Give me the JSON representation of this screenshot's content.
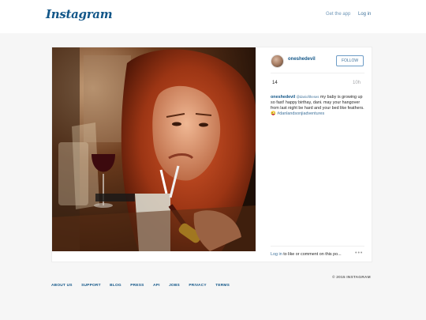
{
  "header": {
    "logo": "Instagram",
    "get_app": "Get the app",
    "login": "Log in"
  },
  "post": {
    "username": "oneshedevil",
    "follow": "FOLLOW",
    "likes": "14",
    "time": "10h",
    "caption": {
      "mention": "@danioftheses",
      "text": "my baby is growing up so fast! happy birthay, dani. may your hangover from last night be hard and your bed like feathers. 😜",
      "hashtag": "#danlandsonjiadventures"
    },
    "comment_prompt": {
      "login": "Log in",
      "rest": "to like or comment on this po..."
    },
    "more": "•••"
  },
  "footer": {
    "links": [
      "ABOUT US",
      "SUPPORT",
      "BLOG",
      "PRESS",
      "API",
      "JOBS",
      "PRIVACY",
      "TERMS"
    ],
    "copyright": "© 2015 INSTAGRAM"
  },
  "colors": {
    "brand": "#125688",
    "link": "#3f729b",
    "background": "#f6f6f6"
  },
  "icons": {
    "more": "more-options-icon",
    "avatar": "user-avatar"
  }
}
